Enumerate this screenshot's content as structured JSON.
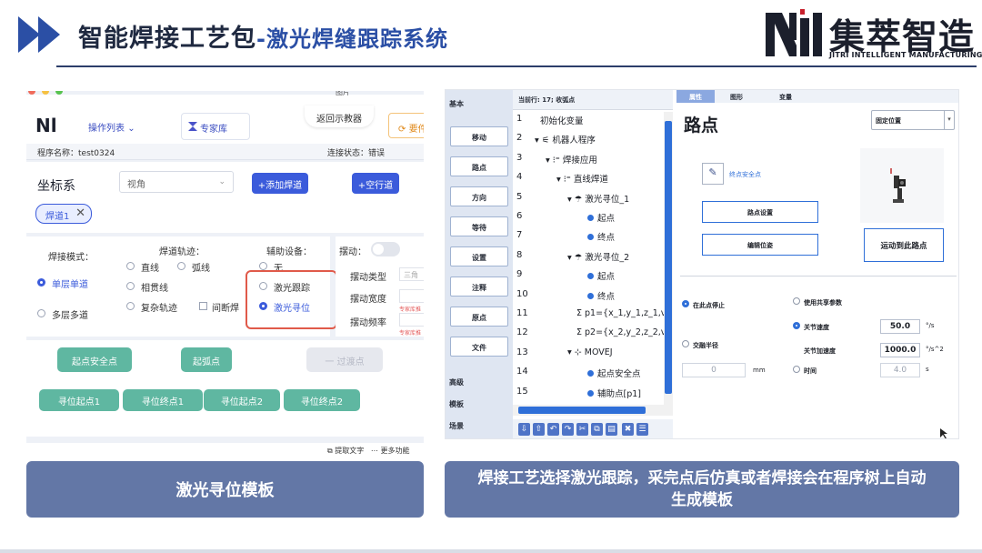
{
  "header": {
    "title_main": "智能焊接工艺包",
    "title_dash": "-",
    "title_sub": "激光焊缝跟踪系统",
    "brand_cn": "集萃智造",
    "brand_en": "JITRI INTELLIGENT MANUFACTURING",
    "colors": {
      "title": "#1f2940",
      "subtitle": "#2b4fa5",
      "arrow": "#2b4fa5"
    }
  },
  "left_app": {
    "top_header_fragment": "图片",
    "logo": "Nl",
    "op_list": "操作列表",
    "expert_lib": "专家库",
    "return_teach": "返回示教器",
    "right_btn": "要件",
    "program_name": "程序名称：test0324",
    "conn_status": "连接状态：错误",
    "coord_label": "坐标系",
    "view_select": "视角",
    "add_weld": "+添加焊道",
    "add_empty": "+空行道",
    "weld_tag": "焊道1",
    "weld_mode_label": "焊接模式：",
    "mode_single": "单层单道",
    "mode_multi": "多层多道",
    "track_label": "焊道轨迹：",
    "track_line": "直线",
    "track_arc": "弧线",
    "track_through": "相贯线",
    "track_complex": "复杂轨迹",
    "track_intermittent": "间断焊",
    "aux_label": "辅助设备：",
    "aux_none": "无",
    "aux_track": "激光跟踪",
    "aux_seek": "激光寻位",
    "swing_label": "摆动：",
    "swing_type": "摆动类型",
    "swing_type_val": "三角",
    "swing_width": "摆动宽度",
    "swing_freq": "摆动频率",
    "hint_1": "专家库推",
    "hint_2": "专家库推",
    "btn_start_safe": "起点安全点",
    "btn_arc_start": "起弧点",
    "btn_transition": "一 过渡点",
    "btn_seek_start1": "寻位起点1",
    "btn_seek_end1": "寻位终点1",
    "btn_seek_start2": "寻位起点2",
    "btn_seek_end2": "寻位终点2",
    "toolbar_extract": "提取文字",
    "toolbar_more": "更多功能",
    "accent": "#3b5bdb",
    "green": "#5fb7a1"
  },
  "left_caption": "激光寻位模板",
  "right_app": {
    "categories_top": "基本",
    "side_buttons": [
      "移动",
      "路点",
      "方向",
      "等待",
      "设置",
      "注释",
      "原点",
      "文件"
    ],
    "categories_bottom": [
      "高级",
      "模板",
      "场景"
    ],
    "current_line": "当前行: 17; 收弧点",
    "tree": [
      {
        "n": "1",
        "t": "初始化变量"
      },
      {
        "n": "2",
        "t": "▾ ⚟ 机器人程序"
      },
      {
        "n": "3",
        "t": "▾ ⁝⁼ 焊接应用"
      },
      {
        "n": "4",
        "t": "▾ ⁝⁼ 直线焊道"
      },
      {
        "n": "5",
        "t": "▾ ☂ 激光寻位_1"
      },
      {
        "n": "6",
        "t": "起点"
      },
      {
        "n": "7",
        "t": "终点"
      },
      {
        "n": "8",
        "t": "▾ ☂ 激光寻位_2"
      },
      {
        "n": "9",
        "t": "起点"
      },
      {
        "n": "10",
        "t": "终点"
      },
      {
        "n": "11",
        "t": "Σ p1={x_1,y_1,z_1,v"
      },
      {
        "n": "12",
        "t": "Σ p2={x_2,y_2,z_2,v"
      },
      {
        "n": "13",
        "t": "▾ ⊹ MOVEJ"
      },
      {
        "n": "14",
        "t": "起点安全点"
      },
      {
        "n": "15",
        "t": "辅助点[p1]"
      }
    ],
    "tabs": [
      "属性",
      "图形",
      "变量"
    ],
    "panel_title": "路点",
    "position_select": "固定位置",
    "link_text": "终点安全点",
    "btn_waypoint_set": "路点设置",
    "btn_edit_pose": "编辑位姿",
    "btn_move_here": "运动到此路点",
    "stop_here": "在此点停止",
    "blend_radius": "交融半径",
    "blend_value": "0",
    "blend_unit": "mm",
    "use_shared": "使用共享参数",
    "joint_speed": "关节速度",
    "joint_speed_val": "50.0",
    "joint_speed_unit": "°/s",
    "joint_accel": "关节加速度",
    "joint_accel_val": "1000.0",
    "joint_accel_unit": "°/s^2",
    "time": "时间",
    "time_val": "4.0",
    "time_unit": "s",
    "accent": "#2f6fd8"
  },
  "right_caption": "焊接工艺选择激光跟踪，采完点后仿真或者焊接会在程序树上自动生成模板"
}
